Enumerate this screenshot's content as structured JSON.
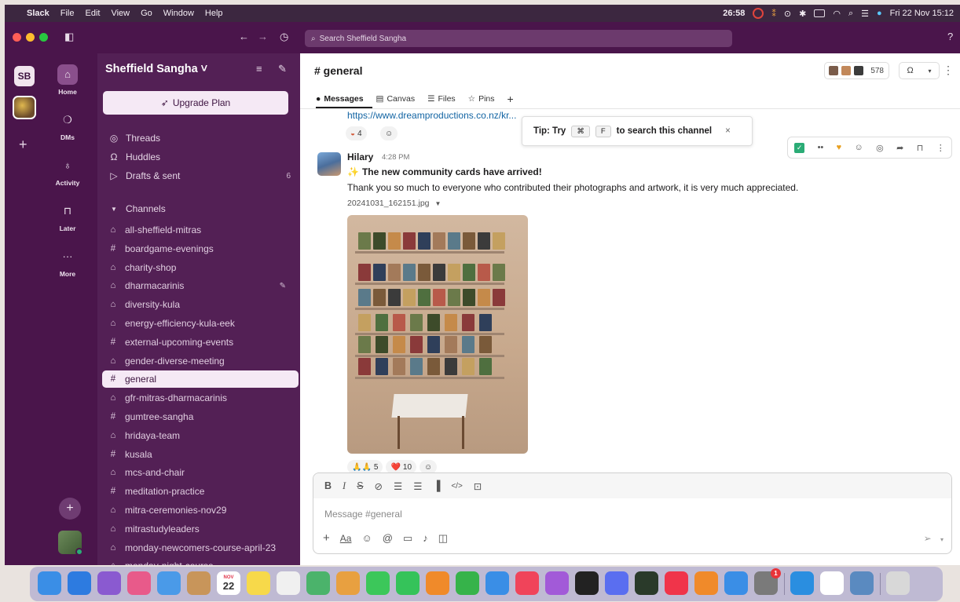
{
  "menubar": {
    "app": "Slack",
    "items": [
      "File",
      "Edit",
      "View",
      "Go",
      "Window",
      "Help"
    ],
    "timer": "26:58",
    "datetime": "Fri 22 Nov 15:12"
  },
  "titlebar": {
    "search_placeholder": "Search Sheffield Sangha"
  },
  "rail": {
    "workspace_initials": "SB",
    "items": [
      {
        "label": "Home",
        "icon": "home-icon"
      },
      {
        "label": "DMs",
        "icon": "dm-icon"
      },
      {
        "label": "Activity",
        "icon": "bell-icon"
      },
      {
        "label": "Later",
        "icon": "bookmark-icon"
      },
      {
        "label": "More",
        "icon": "ellipsis-icon"
      }
    ]
  },
  "sidebar": {
    "workspace_name": "Sheffield Sangha ˅",
    "upgrade_label": "Upgrade Plan",
    "nav": [
      {
        "label": "Threads",
        "icon": "threads-icon"
      },
      {
        "label": "Huddles",
        "icon": "headphones-icon"
      },
      {
        "label": "Drafts & sent",
        "icon": "send-icon",
        "count": "6"
      }
    ],
    "channels_header": "Channels",
    "channels": [
      {
        "name": "all-sheffield-mitras",
        "private": true
      },
      {
        "name": "boardgame-evenings",
        "private": false
      },
      {
        "name": "charity-shop",
        "private": true
      },
      {
        "name": "dharmacarinis",
        "private": true
      },
      {
        "name": "diversity-kula",
        "private": true
      },
      {
        "name": "energy-efficiency-kula-eek",
        "private": true
      },
      {
        "name": "external-upcoming-events",
        "private": false
      },
      {
        "name": "gender-diverse-meeting",
        "private": true
      },
      {
        "name": "general",
        "private": false
      },
      {
        "name": "gfr-mitras-dharmacarinis",
        "private": true
      },
      {
        "name": "gumtree-sangha",
        "private": false
      },
      {
        "name": "hridaya-team",
        "private": true
      },
      {
        "name": "kusala",
        "private": false
      },
      {
        "name": "mcs-and-chair",
        "private": true
      },
      {
        "name": "meditation-practice",
        "private": false
      },
      {
        "name": "mitra-ceremonies-nov29",
        "private": true
      },
      {
        "name": "mitrastudyleaders",
        "private": true
      },
      {
        "name": "monday-newcomers-course-april-23",
        "private": true
      },
      {
        "name": "monday-night-course",
        "private": true
      }
    ]
  },
  "channel": {
    "title": "# general",
    "member_count": "578",
    "tabs": [
      "Messages",
      "Canvas",
      "Files",
      "Pins"
    ],
    "prev_link": "https://www.dreamproductions.co.nz/kr...",
    "prev_reaction_count": "4",
    "tip": {
      "prefix": "Tip: Try",
      "key1": "⌘",
      "key2": "F",
      "suffix": "to search this channel"
    },
    "message": {
      "author": "Hilary",
      "time": "4:28 PM",
      "headline": "The new community cards have arrived!",
      "body": "Thank you so much to everyone who contributed their photographs and artwork, it is very much appreciated.",
      "attachment": "20241031_162151.jpg",
      "reactions": [
        {
          "emoji": "🙏🙏",
          "count": "5"
        },
        {
          "emoji": "❤️",
          "count": "10"
        }
      ]
    },
    "composer_placeholder": "Message #general"
  },
  "dock": {
    "calendar_month": "NOV",
    "calendar_day": "22",
    "badge_count": "1"
  }
}
